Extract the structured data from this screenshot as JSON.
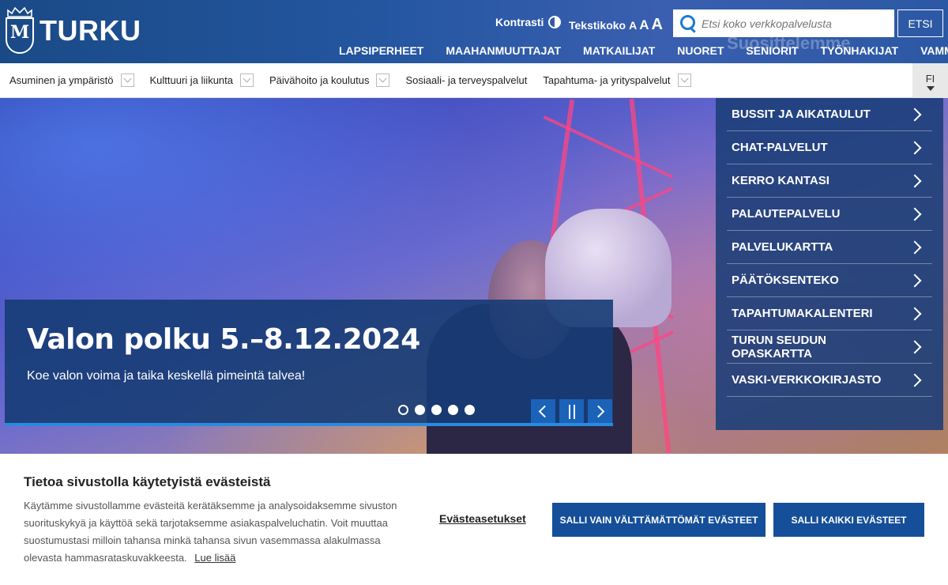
{
  "header": {
    "logo_text": "TURKU",
    "contrast_label": "Kontrasti",
    "textsize_label": "Tekstikoko",
    "textsize_letters": [
      "A",
      "A",
      "A"
    ],
    "search_placeholder": "Etsi koko verkkopalvelusta",
    "search_button": "ETSI",
    "ghost_text": "Suosittelemme",
    "audience": [
      "LAPSIPERHEET",
      "MAAHANMUUTTAJAT",
      "MATKAILIJAT",
      "NUORET",
      "SENIORIT",
      "TYÖNHAKIJAT",
      "VAMMAISET"
    ]
  },
  "categories": [
    "Asuminen ja ympäristö",
    "Kulttuuri ja liikunta",
    "Päivähoito ja koulutus",
    "Sosiaali- ja terveyspalvelut",
    "Tapahtuma- ja yrityspalvelut"
  ],
  "language": "FI",
  "hero": {
    "title": "Valon polku 5.–8.12.2024",
    "subtitle": "Koe valon voima ja taika keskellä pimeintä talvea!",
    "slide_count": 5,
    "active_slide": 1
  },
  "quick_links": [
    "BUSSIT JA AIKATAULUT",
    "CHAT-PALVELUT",
    "KERRO KANTASI",
    "PALAUTEPALVELU",
    "PALVELUKARTTA",
    "PÄÄTÖKSENTEKO",
    "TAPAHTUMAKALENTERI",
    "TURUN SEUDUN OPASKARTTA",
    "VASKI-VERKKOKIRJASTO"
  ],
  "cookie": {
    "title": "Tietoa sivustolla käytetyistä evästeistä",
    "text": "Käytämme sivustollamme evästeitä kerätäksemme ja analysoidaksemme sivuston suorituskykyä ja käyttöä sekä tarjotaksemme asiakaspalveluchatin. Voit muuttaa suostumustasi milloin tahansa minkä tahansa sivun vasemmassa alakulmassa olevasta hammasrataskuvakkeesta.",
    "read_more": "Lue lisää",
    "settings_link": "Evästeasetukset",
    "necessary_button": "SALLI VAIN VÄLTTÄMÄTTÖMÄT EVÄSTEET",
    "all_button": "SALLI KAIKKI EVÄSTEET"
  }
}
